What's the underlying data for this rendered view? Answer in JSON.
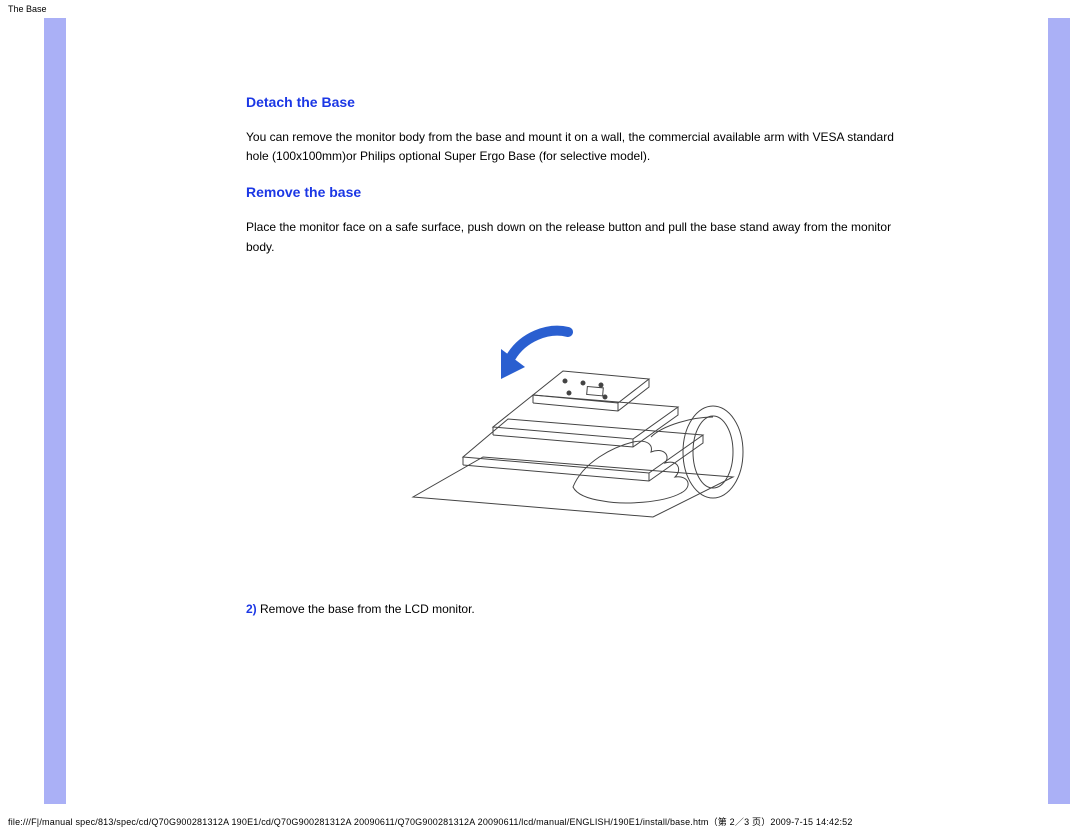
{
  "page_title": "The Base",
  "headings": {
    "detach": "Detach the Base",
    "remove": "Remove the base"
  },
  "paragraphs": {
    "detach_desc": "You can remove the monitor body from the base and mount it on a wall, the commercial available arm with VESA standard hole (100x100mm)or Philips optional Super Ergo Base (for selective model).",
    "remove_desc": "Place the monitor face on a safe surface, push down on the release button and pull the base stand away from the monitor body."
  },
  "step2": {
    "num": "2)",
    "text": " Remove  the base from the LCD monitor."
  },
  "footer": "file:///F|/manual spec/813/spec/cd/Q70G900281312A 190E1/cd/Q70G900281312A 20090611/Q70G900281312A 20090611/lcd/manual/ENGLISH/190E1/install/base.htm（第 2／3 页）2009-7-15 14:42:52"
}
